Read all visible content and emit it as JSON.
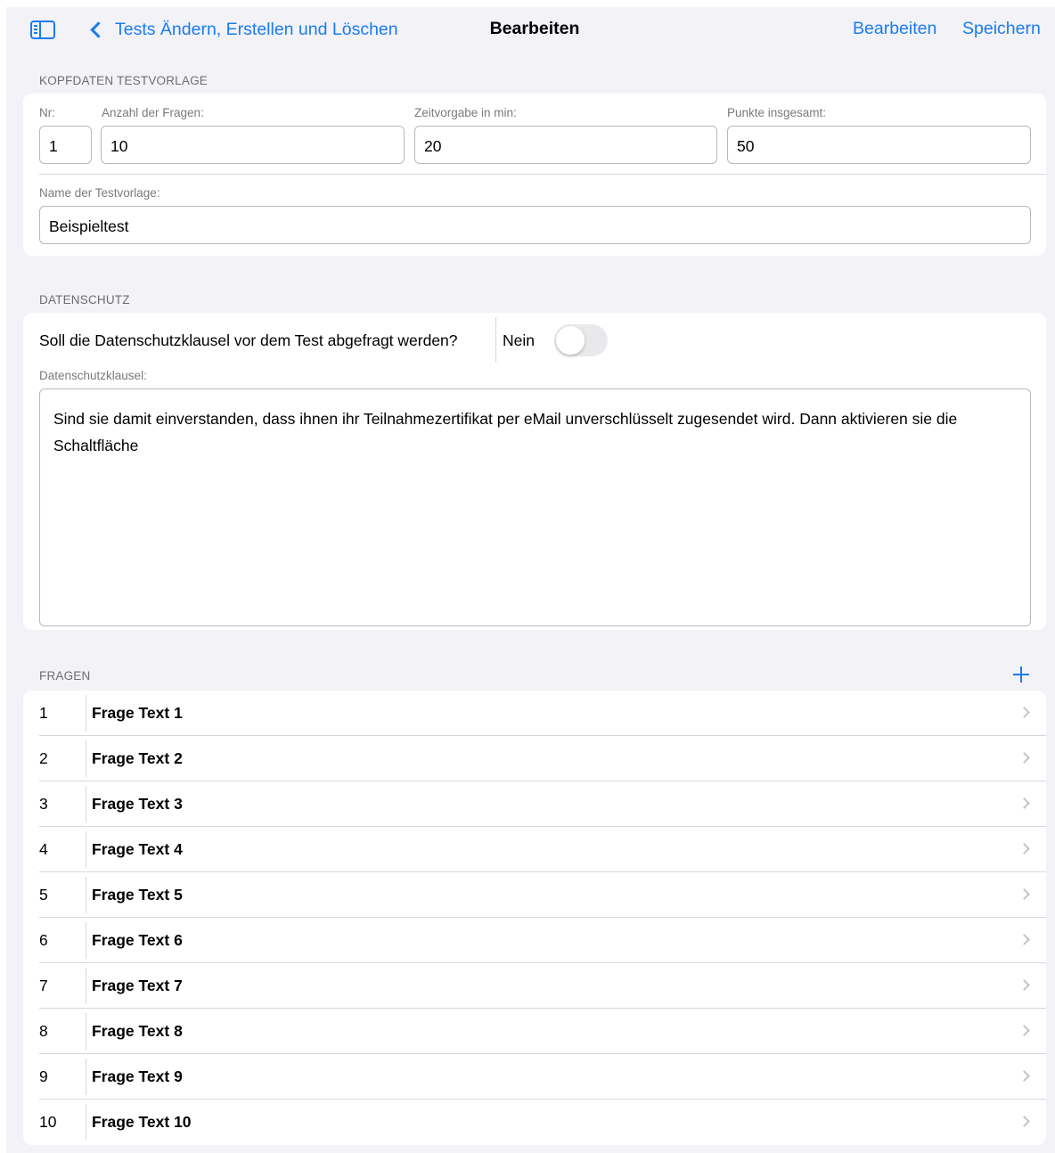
{
  "nav": {
    "back_label": "Tests Ändern, Erstellen und Löschen",
    "title": "Bearbeiten",
    "edit_label": "Bearbeiten",
    "save_label": "Speichern"
  },
  "kopfdaten": {
    "header": "KOPFDATEN TESTVORLAGE",
    "nr_label": "Nr:",
    "nr_value": "1",
    "anzahl_label": "Anzahl der Fragen:",
    "anzahl_value": "10",
    "zeit_label": "Zeitvorgabe in min:",
    "zeit_value": "20",
    "punkte_label": "Punkte insgesamt:",
    "punkte_value": "50",
    "name_label": "Name der Testvorlage:",
    "name_value": "Beispieltest"
  },
  "datenschutz": {
    "header": "DATENSCHUTZ",
    "question": "Soll die Datenschutzklausel vor dem Test abgefragt werden?",
    "toggle_text": "Nein",
    "toggle_on": false,
    "clause_label": "Datenschutzklausel:",
    "clause_text": "Sind sie damit einverstanden, dass ihnen ihr Teilnahmezertifikat per eMail unverschlüsselt zugesendet wird. Dann aktivieren sie die Schaltfläche"
  },
  "fragen": {
    "header": "FRAGEN",
    "items": [
      {
        "num": "1",
        "text": "Frage Text 1"
      },
      {
        "num": "2",
        "text": "Frage Text 2"
      },
      {
        "num": "3",
        "text": "Frage Text 3"
      },
      {
        "num": "4",
        "text": "Frage Text 4"
      },
      {
        "num": "5",
        "text": "Frage Text 5"
      },
      {
        "num": "6",
        "text": "Frage Text 6"
      },
      {
        "num": "7",
        "text": "Frage Text 7"
      },
      {
        "num": "8",
        "text": "Frage Text 8"
      },
      {
        "num": "9",
        "text": "Frage Text 9"
      },
      {
        "num": "10",
        "text": "Frage Text 10"
      }
    ]
  },
  "icons": {
    "sidebar": "sidebar-toggle-icon",
    "back": "chevron-left-icon",
    "add": "plus-icon",
    "row": "chevron-right-icon"
  },
  "colors": {
    "accent": "#1a7cf0",
    "background": "#f2f2f7"
  }
}
